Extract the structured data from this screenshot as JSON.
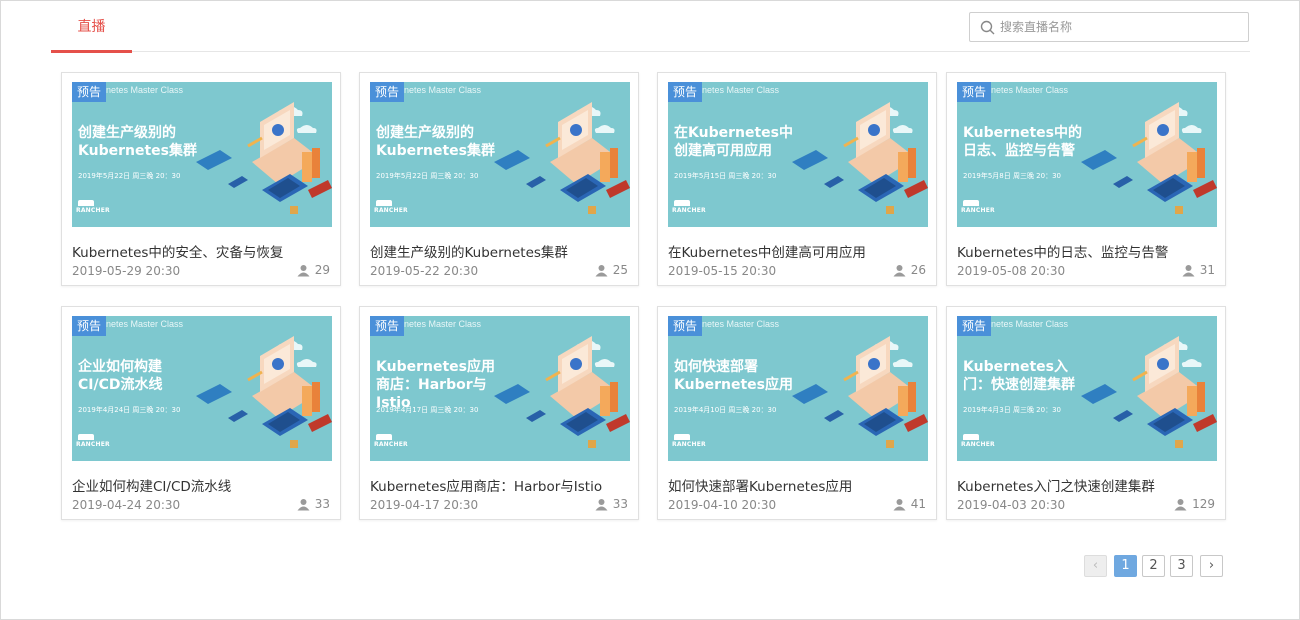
{
  "tabs": [
    {
      "label": "直播"
    }
  ],
  "search": {
    "placeholder": "搜索直播名称"
  },
  "thumbnail": {
    "badge": "预告",
    "series": "netes Master Class",
    "brand": "RANCHER"
  },
  "cards": [
    {
      "thumb_title": "创建生产级别的Kubernetes集群",
      "thumb_date": "2019年5月22日 周三晚 20：30",
      "title": "Kubernetes中的安全、灾备与恢复",
      "date": "2019-05-29 20:30",
      "views": "29"
    },
    {
      "thumb_title": "创建生产级别的Kubernetes集群",
      "thumb_date": "2019年5月22日 周三晚 20：30",
      "title": "创建生产级别的Kubernetes集群",
      "date": "2019-05-22 20:30",
      "views": "25"
    },
    {
      "thumb_title": "在Kubernetes中创建高可用应用",
      "thumb_date": "2019年5月15日 周三晚 20：30",
      "title": "在Kubernetes中创建高可用应用",
      "date": "2019-05-15 20:30",
      "views": "26"
    },
    {
      "thumb_title": "Kubernetes中的日志、监控与告警",
      "thumb_date": "2019年5月8日 周三晚 20：30",
      "title": "Kubernetes中的日志、监控与告警",
      "date": "2019-05-08 20:30",
      "views": "31"
    },
    {
      "thumb_title": "企业如何构建CI/CD流水线",
      "thumb_date": "2019年4月24日 周三晚 20：30",
      "title": "企业如何构建CI/CD流水线",
      "date": "2019-04-24 20:30",
      "views": "33"
    },
    {
      "thumb_title": "Kubernetes应用商店：Harbor与Istio",
      "thumb_date": "2019年4月17日 周三晚 20：30",
      "title": "Kubernetes应用商店：Harbor与Istio",
      "date": "2019-04-17 20:30",
      "views": "33"
    },
    {
      "thumb_title": "如何快速部署Kubernetes应用",
      "thumb_date": "2019年4月10日 周三晚 20：30",
      "title": "如何快速部署Kubernetes应用",
      "date": "2019-04-10 20:30",
      "views": "41"
    },
    {
      "thumb_title": "Kubernetes入门：快速创建集群",
      "thumb_date": "2019年4月3日 周三晚 20：30",
      "title": "Kubernetes入门之快速创建集群",
      "date": "2019-04-03 20:30",
      "views": "129"
    }
  ],
  "pagination": {
    "prev": "‹",
    "pages": [
      "1",
      "2",
      "3"
    ],
    "current": "1",
    "next": "›"
  },
  "icons": {
    "search": "search-icon",
    "views": "user-icon"
  },
  "colors": {
    "accent": "#e5504a",
    "thumb_bg": "#7ec8cf",
    "badge": "#4a90d9",
    "page_active": "#6fa8e0"
  }
}
